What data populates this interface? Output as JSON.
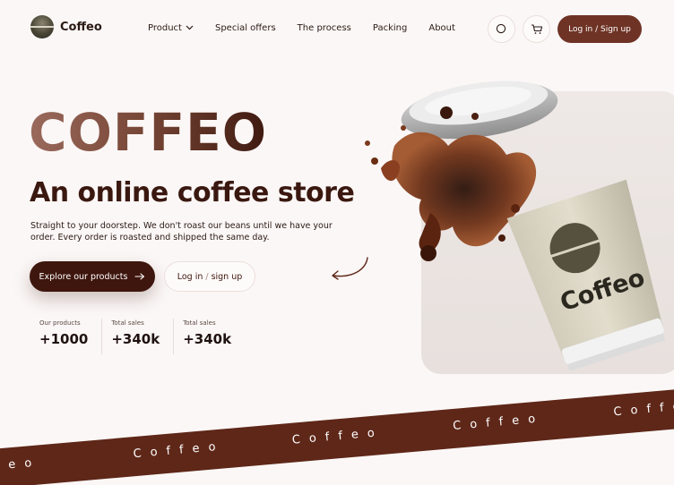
{
  "brand": {
    "name": "Coffeo"
  },
  "nav": {
    "items": [
      {
        "label": "Product",
        "has_dropdown": true
      },
      {
        "label": "Special offers"
      },
      {
        "label": "The process"
      },
      {
        "label": "Packing"
      },
      {
        "label": "About"
      }
    ]
  },
  "header": {
    "search_icon": "search-icon",
    "cart_icon": "cart-icon",
    "login_label": "Log in / Sign up"
  },
  "hero": {
    "brand_title": "COFFEO",
    "title": "An online coffee store",
    "description": "Straight to your doorstep. We don't roast our beans until we have your order. Every order is roasted and shipped the same day.",
    "primary_button": "Explore our products",
    "secondary_login": "Log in",
    "secondary_slash": "/",
    "secondary_signup": "sign up",
    "cup_text": "Coffeo"
  },
  "stats": [
    {
      "label": "Our products",
      "value": "+1000"
    },
    {
      "label": "Total sales",
      "value": "+340k"
    },
    {
      "label": "Total sales",
      "value": "+340k"
    }
  ],
  "ticker": {
    "words": [
      "Coffeo",
      "Coffeo",
      "Coffeo",
      "Coffeo",
      "Coffeo"
    ]
  },
  "colors": {
    "accent": "#6f3325",
    "dark_button": "#3e160d",
    "band": "#5e2718",
    "background": "#fbf7f6"
  }
}
